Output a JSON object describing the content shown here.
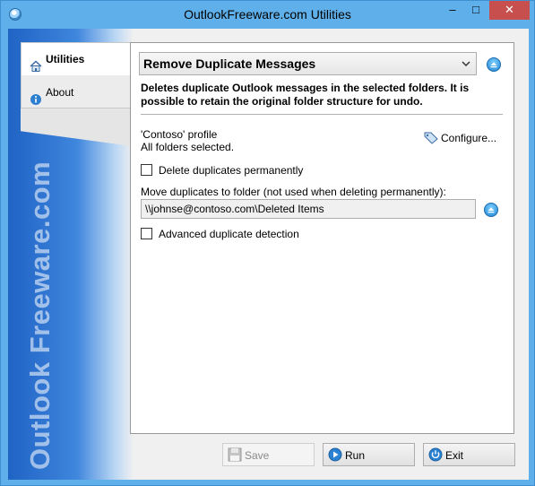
{
  "window": {
    "title": "OutlookFreeware.com Utilities",
    "minimize_glyph": "–",
    "maximize_glyph": "□",
    "close_glyph": "✕"
  },
  "brand": {
    "text": "Outlook Freeware.com"
  },
  "sidebar": {
    "items": [
      {
        "label": "Utilities",
        "icon": "home-icon",
        "active": true
      },
      {
        "label": "About",
        "icon": "info-icon",
        "active": false
      }
    ]
  },
  "utility": {
    "selected": "Remove Duplicate Messages",
    "description": "Deletes duplicate Outlook messages in the selected folders. It is possible to retain the original folder structure for undo.",
    "profile_name": "'Contoso' profile",
    "folders_status": "All folders selected.",
    "configure_label": "Configure...",
    "delete_permanently_label": "Delete duplicates permanently",
    "delete_permanently_checked": false,
    "move_label": "Move duplicates to folder (not used when deleting permanently):",
    "move_folder_value": "\\\\johnse@contoso.com\\Deleted Items",
    "advanced_label": "Advanced duplicate detection",
    "advanced_checked": false
  },
  "buttons": {
    "save_label": "Save",
    "run_label": "Run",
    "exit_label": "Exit"
  },
  "colors": {
    "title_bar": "#5fb0ea",
    "close_button": "#c7504f",
    "accent_blue": "#1f84d2"
  }
}
